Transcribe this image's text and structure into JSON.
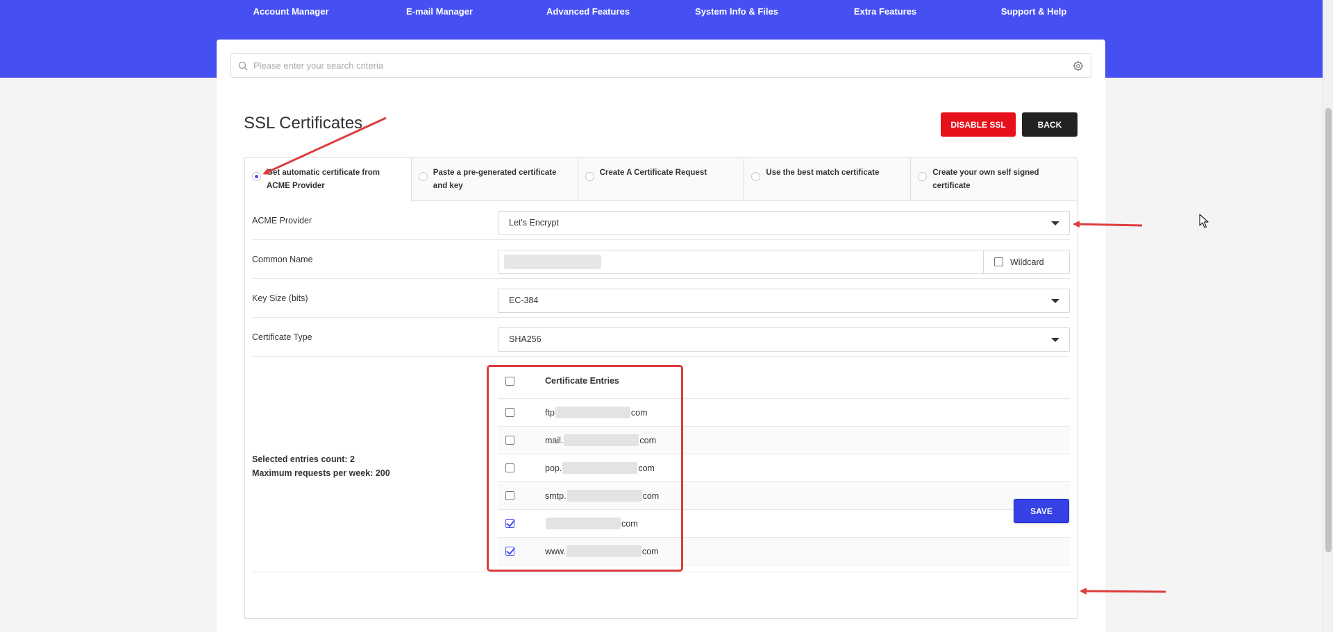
{
  "nav": {
    "items": [
      {
        "label": "Account Manager"
      },
      {
        "label": "E-mail Manager"
      },
      {
        "label": "Advanced Features"
      },
      {
        "label": "System Info & Files"
      },
      {
        "label": "Extra Features"
      },
      {
        "label": "Support & Help"
      }
    ]
  },
  "search": {
    "placeholder": "Please enter your search criteria",
    "icon": "search-icon",
    "settings_icon": "gear-icon"
  },
  "page": {
    "title": "SSL Certificates",
    "disable_ssl_label": "DISABLE SSL",
    "back_label": "BACK",
    "save_label": "SAVE"
  },
  "tabs": [
    {
      "label": "Get automatic certificate from ACME Provider",
      "selected": true
    },
    {
      "label": "Paste a pre-generated certificate and key",
      "selected": false
    },
    {
      "label": "Create A Certificate Request",
      "selected": false
    },
    {
      "label": "Use the best match certificate",
      "selected": false
    },
    {
      "label": "Create your own self signed certificate",
      "selected": false
    }
  ],
  "form": {
    "acme_provider": {
      "label": "ACME Provider",
      "value": "Let's Encrypt"
    },
    "common_name": {
      "label": "Common Name",
      "value": "",
      "wildcard_label": "Wildcard",
      "wildcard_checked": false
    },
    "key_size": {
      "label": "Key Size (bits)",
      "value": "EC-384"
    },
    "certificate_type": {
      "label": "Certificate Type",
      "value": "SHA256"
    }
  },
  "entries": {
    "header": "Certificate Entries",
    "selected_count_label": "Selected entries count: 2",
    "max_requests_label": "Maximum requests per week: 200",
    "rows": [
      {
        "prefix": "ftp",
        "suffix": "com",
        "checked": false
      },
      {
        "prefix": "mail.",
        "suffix": "com",
        "checked": false
      },
      {
        "prefix": "pop.",
        "suffix": "com",
        "checked": false
      },
      {
        "prefix": "smtp.",
        "suffix": "com",
        "checked": false
      },
      {
        "prefix": "",
        "suffix": "com",
        "checked": true
      },
      {
        "prefix": "www.",
        "suffix": "com",
        "checked": true
      }
    ]
  },
  "colors": {
    "brand": "#4650f2",
    "danger": "#e8101a",
    "annotation": "#dc3c3c"
  }
}
